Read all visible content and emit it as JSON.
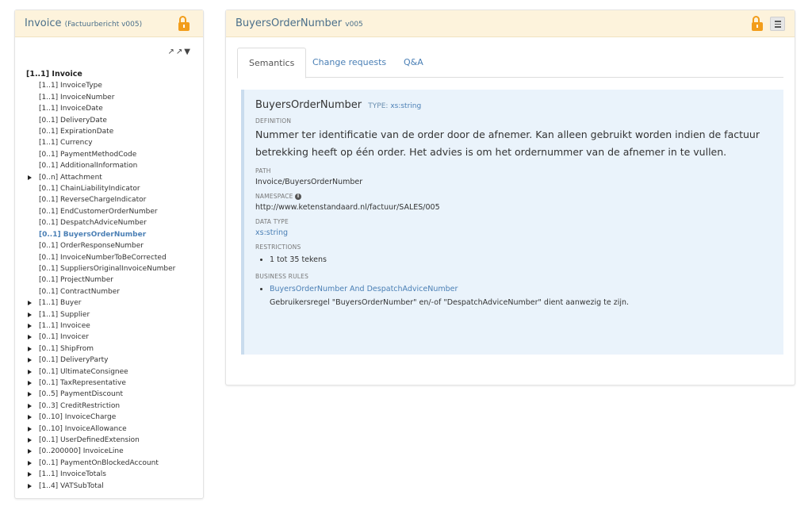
{
  "left_panel": {
    "title": "Invoice",
    "subtitle": "(Factuurbericht v005)",
    "tools": "↗↗▼",
    "root_label": "[1..1] Invoice",
    "items": [
      {
        "label": "[1..1] InvoiceType",
        "expandable": false,
        "selected": false
      },
      {
        "label": "[1..1] InvoiceNumber",
        "expandable": false,
        "selected": false
      },
      {
        "label": "[1..1] InvoiceDate",
        "expandable": false,
        "selected": false
      },
      {
        "label": "[0..1] DeliveryDate",
        "expandable": false,
        "selected": false
      },
      {
        "label": "[0..1] ExpirationDate",
        "expandable": false,
        "selected": false
      },
      {
        "label": "[1..1] Currency",
        "expandable": false,
        "selected": false
      },
      {
        "label": "[0..1] PaymentMethodCode",
        "expandable": false,
        "selected": false
      },
      {
        "label": "[0..1] AdditionalInformation",
        "expandable": false,
        "selected": false
      },
      {
        "label": "[0..n] Attachment",
        "expandable": true,
        "selected": false
      },
      {
        "label": "[0..1] ChainLiabilityIndicator",
        "expandable": false,
        "selected": false
      },
      {
        "label": "[0..1] ReverseChargeIndicator",
        "expandable": false,
        "selected": false
      },
      {
        "label": "[0..1] EndCustomerOrderNumber",
        "expandable": false,
        "selected": false
      },
      {
        "label": "[0..1] DespatchAdviceNumber",
        "expandable": false,
        "selected": false
      },
      {
        "label": "[0..1] BuyersOrderNumber",
        "expandable": false,
        "selected": true
      },
      {
        "label": "[0..1] OrderResponseNumber",
        "expandable": false,
        "selected": false
      },
      {
        "label": "[0..1] InvoiceNumberToBeCorrected",
        "expandable": false,
        "selected": false
      },
      {
        "label": "[0..1] SuppliersOriginalInvoiceNumber",
        "expandable": false,
        "selected": false
      },
      {
        "label": "[0..1] ProjectNumber",
        "expandable": false,
        "selected": false
      },
      {
        "label": "[0..1] ContractNumber",
        "expandable": false,
        "selected": false
      },
      {
        "label": "[1..1] Buyer",
        "expandable": true,
        "selected": false
      },
      {
        "label": "[1..1] Supplier",
        "expandable": true,
        "selected": false
      },
      {
        "label": "[1..1] Invoicee",
        "expandable": true,
        "selected": false
      },
      {
        "label": "[0..1] Invoicer",
        "expandable": true,
        "selected": false
      },
      {
        "label": "[0..1] ShipFrom",
        "expandable": true,
        "selected": false
      },
      {
        "label": "[0..1] DeliveryParty",
        "expandable": true,
        "selected": false
      },
      {
        "label": "[0..1] UltimateConsignee",
        "expandable": true,
        "selected": false
      },
      {
        "label": "[0..1] TaxRepresentative",
        "expandable": true,
        "selected": false
      },
      {
        "label": "[0..5] PaymentDiscount",
        "expandable": true,
        "selected": false
      },
      {
        "label": "[0..3] CreditRestriction",
        "expandable": true,
        "selected": false
      },
      {
        "label": "[0..10] InvoiceCharge",
        "expandable": true,
        "selected": false
      },
      {
        "label": "[0..10] InvoiceAllowance",
        "expandable": true,
        "selected": false
      },
      {
        "label": "[0..1] UserDefinedExtension",
        "expandable": true,
        "selected": false
      },
      {
        "label": "[0..200000] InvoiceLine",
        "expandable": true,
        "selected": false
      },
      {
        "label": "[0..1] PaymentOnBlockedAccount",
        "expandable": true,
        "selected": false
      },
      {
        "label": "[1..1] InvoiceTotals",
        "expandable": true,
        "selected": false
      },
      {
        "label": "[1..4] VATSubTotal",
        "expandable": true,
        "selected": false
      }
    ]
  },
  "right_panel": {
    "title": "BuyersOrderNumber",
    "subtitle": "v005",
    "tabs": [
      {
        "label": "Semantics",
        "active": true
      },
      {
        "label": "Change requests",
        "active": false
      },
      {
        "label": "Q&A",
        "active": false
      }
    ],
    "content": {
      "name": "BuyersOrderNumber",
      "type_label": "TYPE:",
      "type_value": "xs:string",
      "definition_label": "DEFINITION",
      "definition": "Nummer ter identificatie van de order door de afnemer. Kan alleen gebruikt worden indien de factuur betrekking heeft op één order. Het advies is om het ordernummer van de afnemer in te vullen.",
      "path_label": "PATH",
      "path": "Invoice/BuyersOrderNumber",
      "namespace_label": "NAMESPACE",
      "namespace": "http://www.ketenstandaard.nl/factuur/SALES/005",
      "datatype_label": "DATA TYPE",
      "datatype": "xs:string",
      "restrictions_label": "RESTRICTIONS",
      "restrictions": [
        "1 tot 35 tekens"
      ],
      "business_rules_label": "BUSINESS RULES",
      "business_rules": [
        {
          "name": "BuyersOrderNumber And DespatchAdviceNumber",
          "description": "Gebruikersregel \"BuyersOrderNumber\" en/-of \"DespatchAdviceNumber\" dient aanwezig te zijn."
        }
      ]
    }
  },
  "colors": {
    "header_bg": "#fdf3dc",
    "lock": "#f29d1a",
    "link": "#4a7fb5",
    "content_bg": "#eaf3fb"
  }
}
